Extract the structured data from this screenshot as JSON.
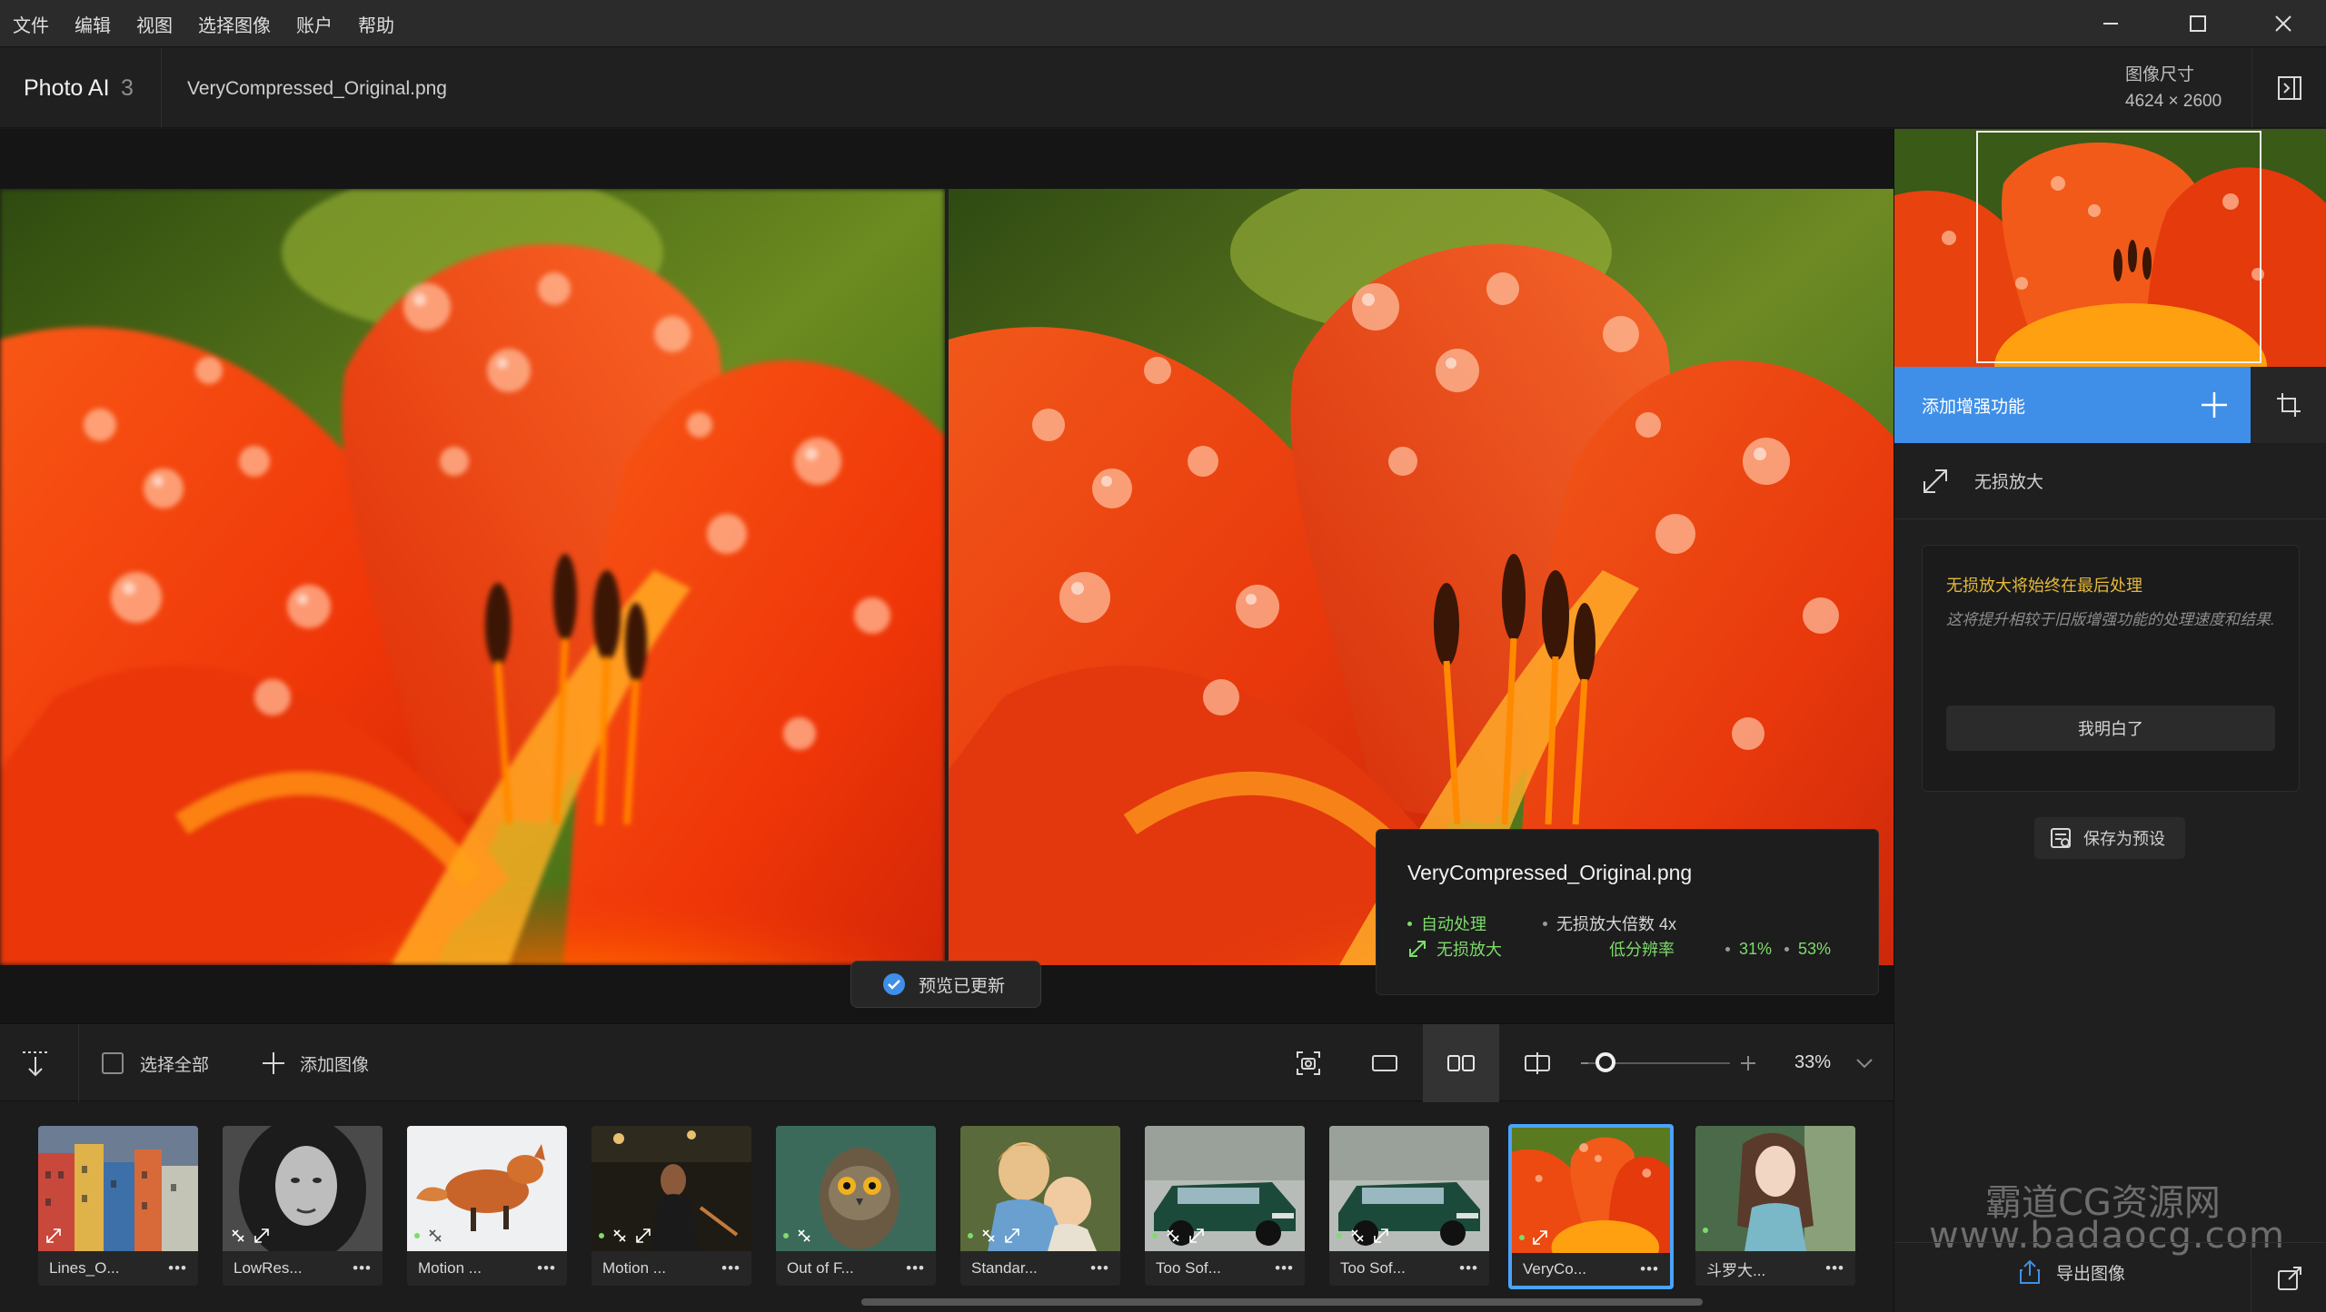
{
  "menu": [
    "文件",
    "编辑",
    "视图",
    "选择图像",
    "账户",
    "帮助"
  ],
  "header": {
    "app_name": "Photo AI",
    "app_version": "3",
    "file_name": "VeryCompressed_Original.png",
    "size_label": "图像尺寸",
    "size_value": "4624 × 2600"
  },
  "info_card": {
    "title": "VeryCompressed_Original.png",
    "auto_process": "自动处理",
    "scale_label": "无损放大倍数 4x",
    "upscale": "无损放大",
    "low_res": "低分辨率",
    "pct1": "31%",
    "pct2": "53%"
  },
  "preview_toast": "预览已更新",
  "toolbar": {
    "select_all": "选择全部",
    "add_image": "添加图像",
    "zoom": "33%",
    "zoom_fraction": 0.12
  },
  "thumbnails": [
    {
      "label": "Lines_O...",
      "badges": [
        "expand"
      ]
    },
    {
      "label": "LowRes...",
      "badges": [
        "denoise",
        "expand"
      ]
    },
    {
      "label": "Motion ...",
      "badges": [
        "dot",
        "denoise"
      ]
    },
    {
      "label": "Motion ...",
      "badges": [
        "dot",
        "denoise",
        "expand"
      ]
    },
    {
      "label": "Out of F...",
      "badges": [
        "dot",
        "denoise"
      ]
    },
    {
      "label": "Standar...",
      "badges": [
        "dot",
        "denoise",
        "expand"
      ]
    },
    {
      "label": "Too Sof...",
      "badges": [
        "dot",
        "denoise",
        "expand"
      ]
    },
    {
      "label": "Too Sof...",
      "badges": [
        "dot",
        "denoise",
        "expand"
      ]
    },
    {
      "label": "VeryCo...",
      "badges": [
        "dot",
        "expand"
      ],
      "active": true
    },
    {
      "label": "斗罗大...",
      "badges": [
        "dot"
      ]
    }
  ],
  "panel": {
    "add_enhancement": "添加增强功能",
    "upscale": "无损放大",
    "notice_title": "无损放大将始终在最后处理",
    "notice_text": "这将提升相较于旧版增强功能的处理速度和结果.",
    "notice_button": "我明白了",
    "save_preset": "保存为预设",
    "export": "导出图像",
    "watermark_line1": "霸道CG资源网",
    "watermark_line2": "www.badaocg.com"
  },
  "colors": {
    "accent": "#3f8fe8",
    "warning": "#e5b93a",
    "success": "#7ddc6b",
    "selection": "#4aa3ff"
  }
}
